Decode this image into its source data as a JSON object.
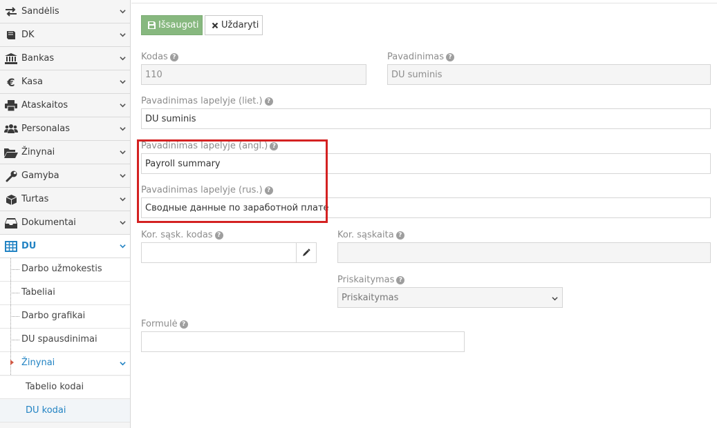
{
  "sidebar": {
    "items": [
      {
        "label": "Sandėlis",
        "icon": "exchange-icon"
      },
      {
        "label": "DK",
        "icon": "book-icon"
      },
      {
        "label": "Bankas",
        "icon": "bank-icon"
      },
      {
        "label": "Kasa",
        "icon": "euro-icon"
      },
      {
        "label": "Ataskaitos",
        "icon": "print-icon"
      },
      {
        "label": "Personalas",
        "icon": "users-icon"
      },
      {
        "label": "Žinynai",
        "icon": "folder-open-icon"
      },
      {
        "label": "Gamyba",
        "icon": "wrench-icon"
      },
      {
        "label": "Turtas",
        "icon": "cube-icon"
      },
      {
        "label": "Dokumentai",
        "icon": "inbox-icon"
      },
      {
        "label": "DU",
        "icon": "table-icon"
      }
    ],
    "du_submenu": [
      {
        "label": "Darbo užmokestis"
      },
      {
        "label": "Tabeliai"
      },
      {
        "label": "Darbo grafikai"
      },
      {
        "label": "DU spausdinimai"
      },
      {
        "label": "Žinynai"
      }
    ],
    "zinynai_submenu": [
      {
        "label": "Tabelio kodai"
      },
      {
        "label": "DU kodai"
      }
    ]
  },
  "toolbar": {
    "save_label": "Išsaugoti",
    "close_label": "Uždaryti"
  },
  "form": {
    "kodas": {
      "label": "Kodas",
      "value": "110"
    },
    "pavadinimas": {
      "label": "Pavadinimas",
      "value": "DU suminis"
    },
    "lapelyje_liet": {
      "label": "Pavadinimas lapelyje (liet.)",
      "value": "DU suminis"
    },
    "lapelyje_angl": {
      "label": "Pavadinimas lapelyje (angl.)",
      "value": "Payroll summary"
    },
    "lapelyje_rus": {
      "label": "Pavadinimas lapelyje (rus.)",
      "value": "Сводные данные по заработной плате"
    },
    "kor_kodas": {
      "label": "Kor. sąsk. kodas",
      "value": ""
    },
    "kor_saskaita": {
      "label": "Kor. sąskaita",
      "value": ""
    },
    "priskaitymas": {
      "label": "Priskaitymas",
      "value": "Priskaitymas"
    },
    "formule": {
      "label": "Formulė",
      "value": ""
    }
  },
  "colors": {
    "accent": "#2283c3",
    "save_button": "#87b87f",
    "highlight": "#d42121"
  }
}
